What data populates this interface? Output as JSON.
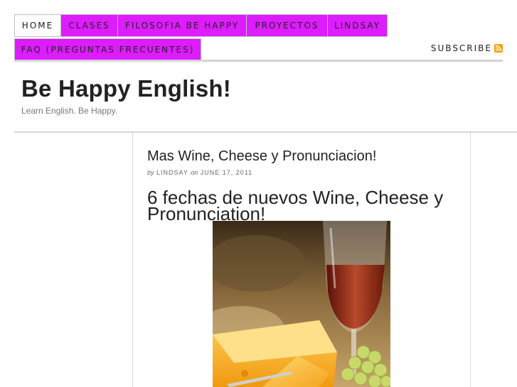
{
  "nav": {
    "items": [
      {
        "label": "HOME",
        "active": true
      },
      {
        "label": "CLASES"
      },
      {
        "label": "FILOSOFIA BE HAPPY"
      },
      {
        "label": "PROYECTOS"
      },
      {
        "label": "LINDSAY"
      },
      {
        "label": "FAQ (PREGUNTAS FRECUENTES)"
      }
    ],
    "subscribe_label": "SUBSCRIBE",
    "subscribe_icon": "rss-icon"
  },
  "header": {
    "title": "Be Happy English!",
    "description": "Learn English. Be Happy."
  },
  "post": {
    "title": "Mas Wine, Cheese y Pronunciacion!",
    "byline_prefix": "by",
    "author": "LINDSAY",
    "byline_on": "on",
    "date": "JUNE 17, 2011",
    "heading": "6 fechas de nuevos Wine, Cheese y Pronunciation!",
    "image": "wine-and-cheese-photo"
  },
  "colors": {
    "nav_accent": "#dd1cff",
    "rss_orange": "#f6a000"
  }
}
